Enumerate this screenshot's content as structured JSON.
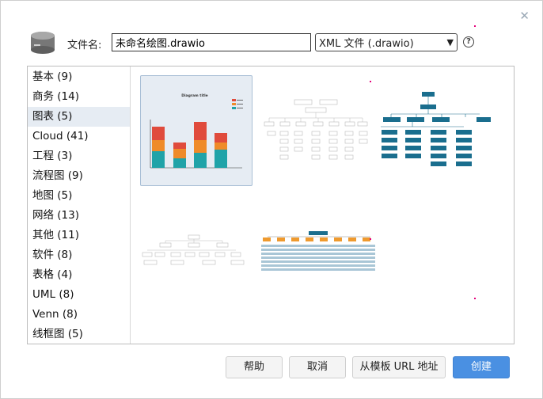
{
  "dialog": {
    "close_icon": "close-icon",
    "filename_label": "文件名:",
    "filename_value": "未命名绘图.drawio",
    "filetype_value": "XML 文件 (.drawio)",
    "help_icon_glyph": "?",
    "colors": {
      "accent": "#4a90e2",
      "selected_bg": "#e6ecf3",
      "template_teal": "#1a6e8e"
    }
  },
  "categories": [
    {
      "label": "基本 (9)"
    },
    {
      "label": "商务 (14)"
    },
    {
      "label": "图表 (5)"
    },
    {
      "label": "Cloud (41)"
    },
    {
      "label": "工程 (3)"
    },
    {
      "label": "流程图 (9)"
    },
    {
      "label": "地图 (5)"
    },
    {
      "label": "网络 (13)"
    },
    {
      "label": "其他 (11)"
    },
    {
      "label": "软件 (8)"
    },
    {
      "label": "表格 (4)"
    },
    {
      "label": "UML (8)"
    },
    {
      "label": "Venn (8)"
    },
    {
      "label": "线框图 (5)"
    }
  ],
  "thumbnail": {
    "chart_title": "Diagram title"
  },
  "buttons": {
    "help": "帮助",
    "cancel": "取消",
    "from_url": "从模板 URL 地址",
    "create": "创建"
  }
}
